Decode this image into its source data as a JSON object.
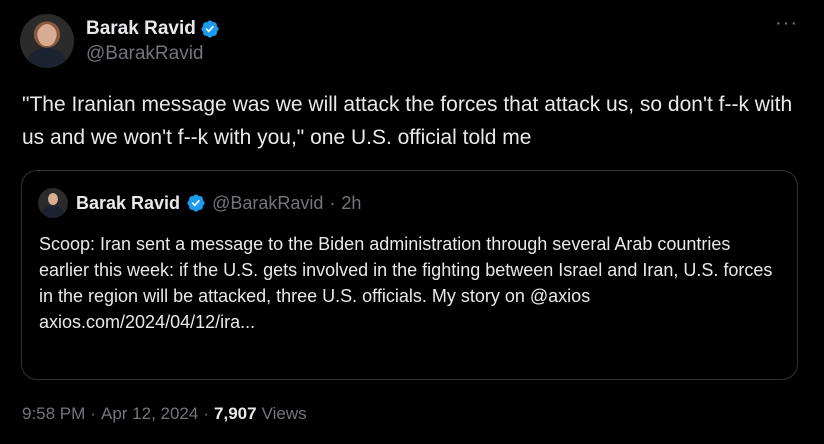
{
  "author": {
    "display_name": "Barak Ravid",
    "handle": "@BarakRavid",
    "avatar_icon": "profile-photo",
    "verified_icon": "verified-badge-icon",
    "verified_color": "#1d9bf0"
  },
  "menu": {
    "more_label": "···"
  },
  "tweet": {
    "text": "\"The Iranian message was we will attack the forces that attack us, so don't f--k with us and we won't f--k with you,\" one U.S. official told me"
  },
  "quoted": {
    "display_name": "Barak Ravid",
    "handle": "@BarakRavid",
    "separator": "·",
    "time": "2h",
    "text": "Scoop: Iran sent a message to the Biden administration through several Arab countries earlier this week: if the U.S. gets involved in the fighting between Israel and Iran, U.S. forces in the region will be attacked, three U.S. officials. My story on @axios",
    "link": "axios.com/2024/04/12/ira..."
  },
  "footer": {
    "time": "9:58 PM",
    "separator1": "·",
    "date": "Apr 12, 2024",
    "separator2": "·",
    "views_count": "7,907",
    "views_label": "Views"
  }
}
